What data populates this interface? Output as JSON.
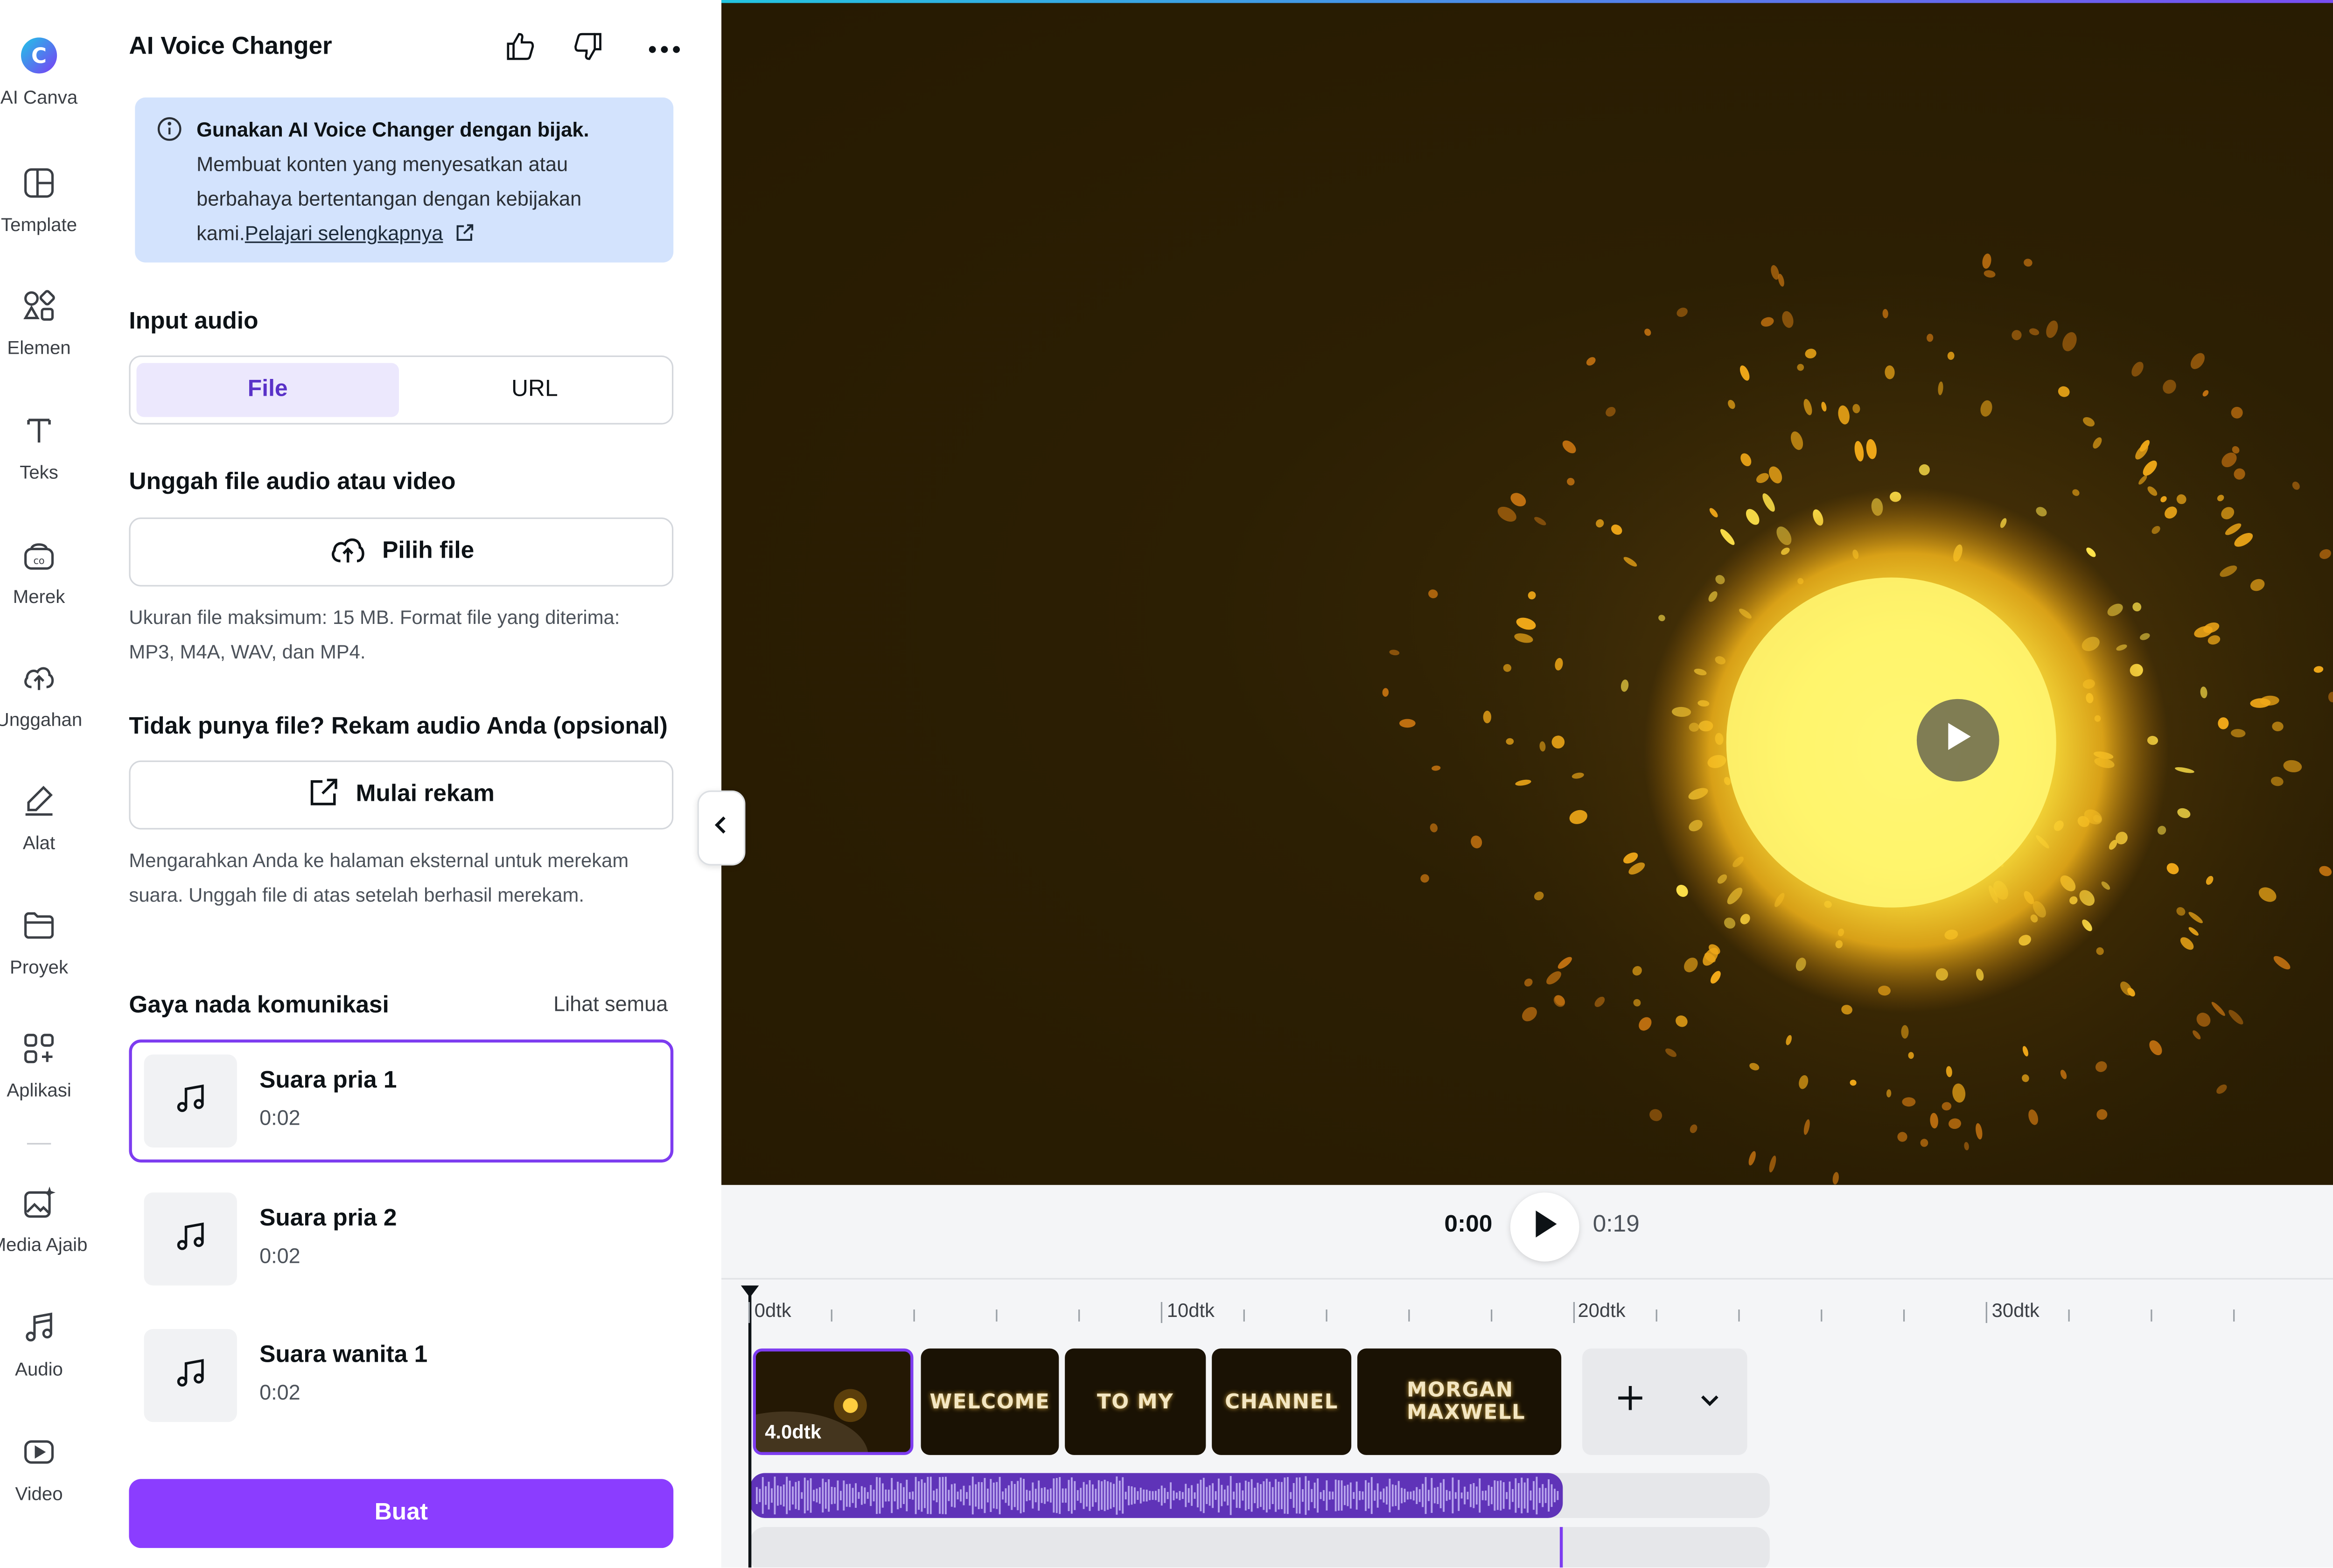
{
  "rail": {
    "items": [
      {
        "label": "AI Canva",
        "icon": "canva-ai-icon"
      },
      {
        "label": "Template",
        "icon": "template-icon"
      },
      {
        "label": "Elemen",
        "icon": "elements-icon"
      },
      {
        "label": "Teks",
        "icon": "text-icon"
      },
      {
        "label": "Merek",
        "icon": "brand-icon"
      },
      {
        "label": "Unggahan",
        "icon": "upload-icon"
      },
      {
        "label": "Alat",
        "icon": "draw-icon"
      },
      {
        "label": "Proyek",
        "icon": "folder-icon"
      },
      {
        "label": "Aplikasi",
        "icon": "apps-icon"
      },
      {
        "label": "Media Ajaib",
        "icon": "magic-media-icon"
      },
      {
        "label": "Audio",
        "icon": "music-icon"
      },
      {
        "label": "Video",
        "icon": "video-icon"
      }
    ]
  },
  "panel": {
    "title": "AI Voice Changer",
    "notice": {
      "bold": "Gunakan AI Voice Changer dengan bijak.",
      "body": "Membuat konten yang menyesatkan atau berbahaya bertentangan dengan kebijakan kami.",
      "link": "Pelajari selengkapnya"
    },
    "input_audio": {
      "title": "Input audio",
      "options": [
        "File",
        "URL"
      ],
      "selected": "File"
    },
    "upload": {
      "title": "Unggah file audio atau video",
      "button": "Pilih file",
      "help": "Ukuran file maksimum: 15 MB. Format file yang diterima: MP3, M4A, WAV, dan MP4."
    },
    "record": {
      "title": "Tidak punya file? Rekam audio Anda (opsional)",
      "button": "Mulai rekam",
      "help": "Mengarahkan Anda ke halaman eksternal untuk merekam suara. Unggah file di atas setelah berhasil merekam."
    },
    "tone": {
      "title": "Gaya nada komunikasi",
      "see_all": "Lihat semua",
      "voices": [
        {
          "name": "Suara pria 1",
          "duration": "0:02",
          "selected": true
        },
        {
          "name": "Suara pria 2",
          "duration": "0:02",
          "selected": false
        },
        {
          "name": "Suara wanita 1",
          "duration": "0:02",
          "selected": false
        }
      ]
    },
    "create_button": "Buat"
  },
  "player": {
    "current": "0:00",
    "total": "0:19"
  },
  "timeline": {
    "ticks": [
      "0dtk",
      "10dtk",
      "20dtk",
      "30dtk"
    ],
    "clips": [
      {
        "text": "",
        "duration": "4.0dtk",
        "selected": true
      },
      {
        "text": "WELCOME"
      },
      {
        "text": "TO MY"
      },
      {
        "text": "CHANNEL"
      },
      {
        "text": "MORGAN MAXWELL"
      }
    ]
  },
  "colors": {
    "accent": "#8b3dff",
    "selection": "#7d3cf0",
    "notice_bg": "#d3e3fd",
    "audio_track": "#5f33b8"
  }
}
